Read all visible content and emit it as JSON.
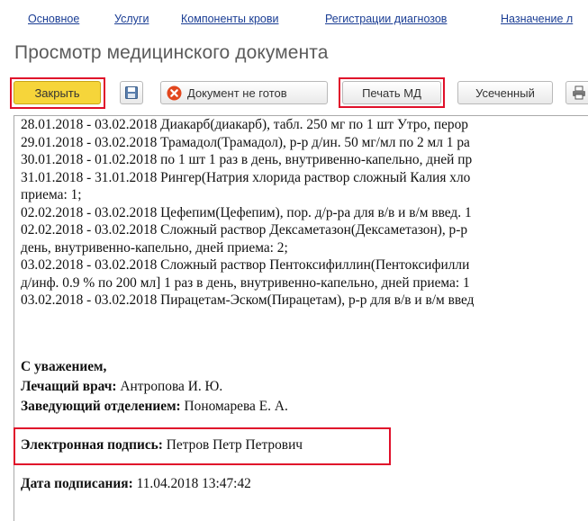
{
  "nav": {
    "links": [
      "Основное",
      "Услуги",
      "Компоненты крови",
      "Регистрации диагнозов",
      "Назначение л"
    ]
  },
  "page_title": "Просмотр медицинского документа",
  "toolbar": {
    "close_label": "Закрыть",
    "save_icon": "floppy-disk-icon",
    "not_ready_label": "Документ не готов",
    "print_label": "Печать МД",
    "short_label": "Усеченный"
  },
  "document": {
    "lines": [
      "28.01.2018 - 03.02.2018 Диакарб(диакарб), табл. 250 мг по 1 шт Утро, перор",
      "29.01.2018 - 03.02.2018 Трамадол(Трамадол), р-р д/ин. 50 мг/мл по 2 мл 1 ра",
      "30.01.2018 - 01.02.2018 по 1 шт 1 раз в день, внутривенно-капельно, дней пр",
      "31.01.2018 - 31.01.2018 Рингер(Натрия хлорида раствор сложный Калия хло",
      "приема: 1;",
      "02.02.2018 - 03.02.2018 Цефепим(Цефепим), пор. д/р-ра для в/в и в/м введ. 1",
      "02.02.2018 - 03.02.2018 Сложный раствор Дексаметазон(Дексаметазон), р-р",
      "день, внутривенно-капельно, дней приема: 2;",
      "03.02.2018 - 03.02.2018 Сложный раствор Пентоксифиллин(Пентоксифилли",
      "д/инф. 0.9 % по 200 мл] 1 раз в день, внутривенно-капельно, дней приема: 1",
      "03.02.2018 - 03.02.2018 Пирацетам-Эском(Пирацетам), р-р для в/в и в/м введ"
    ],
    "regards": "С уважением,",
    "doctor_label": "Лечащий врач:",
    "doctor_name": "Антропова И. Ю.",
    "head_label": "Заведующий отделением:",
    "head_name": "Пономарева Е. А.",
    "esign_label": "Электронная подпись:",
    "esign_name": "Петров Петр Петрович",
    "date_label": "Дата подписания:",
    "date_value": "11.04.2018 13:47:42"
  },
  "colors": {
    "highlight": "#e0102a",
    "close_button": "#f6d53a",
    "link": "#1a3d94"
  }
}
